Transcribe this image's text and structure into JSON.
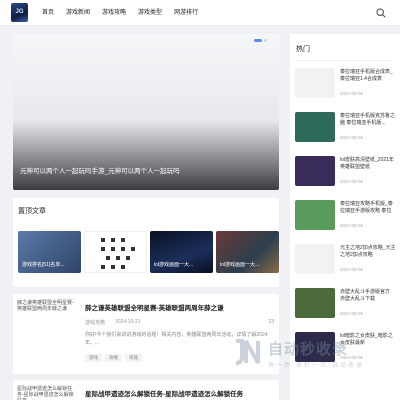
{
  "header": {
    "logo_text": "JG",
    "nav": [
      "首页",
      "游戏新闻",
      "游戏攻略",
      "游戏类型",
      "网游排行"
    ]
  },
  "hero": {
    "caption": "元神可以两个人一起玩吗手游_元神可以两个人一起玩吗"
  },
  "recommended": {
    "title": "置顶文章",
    "cards": [
      {
        "caption": "游戏排名[51]名单..."
      },
      {
        "caption": ""
      },
      {
        "caption": "lol游戏画面一大..."
      },
      {
        "caption": "lol游戏画面一大..."
      }
    ]
  },
  "articles": [
    {
      "thumb_alt": "薛之谦英雄联盟全明星赛-英雄联盟两周年薛之谦",
      "title": "薛之谦英雄联盟全明星赛-英雄联盟两周年薛之谦",
      "author": "游戏攻略",
      "date": "2024-10-21",
      "count": "23",
      "desc": "你好!今个我们来讲讲游戏的话题！相关内容，英雄联盟两周年活动，详情了解2024年。...",
      "tags": [
        "游戏",
        "攻略",
        "英雄"
      ]
    },
    {
      "thumb_alt": "星际战甲遗迹怎么解锁任务-星际战甲遗迹怎么解锁任务",
      "title": "星际战甲遗迹怎么解锁任务-星际战甲遗迹怎么解锁任务"
    }
  ],
  "sidebar": {
    "title": "热门",
    "items": [
      {
        "name": "泰拉瑞亚手机版合成表_泰拉瑞亚1.4合成表",
        "date": "2024-09-06",
        "color": "#f2f2f2"
      },
      {
        "name": "泰拉瑞亚手机版克苏鲁之脑 泰拉瑞亚手机版...",
        "date": "2024-09-06",
        "color": "#2d6a5a"
      },
      {
        "name": "lol皮肤高清壁纸_2021年英雄联盟壁纸",
        "date": "2024-09-06",
        "color": "#3a2c5a"
      },
      {
        "name": "泰拉瑞亚攻略手机版_泰拉瑞亚手游版攻略 泰拉",
        "date": "2024-09-06",
        "color": "#5a9a5a"
      },
      {
        "name": "元主之地2加点攻略_元主之地2加点攻略",
        "date": "2024-09-06",
        "color": "#f2f2f2"
      },
      {
        "name": "赤壁大乱斗手游版官方 赤壁大乱斗下载",
        "date": "2024-09-05",
        "color": "#4a6a3a"
      },
      {
        "name": "lol暗影之女皮肤_暗影之女皮肤最新",
        "date": "2024-09-05",
        "color": "#2c2c4a"
      }
    ]
  },
  "watermark": {
    "text": "自动秒收录",
    "sub": "快一步·来秒一次·自动收录"
  }
}
